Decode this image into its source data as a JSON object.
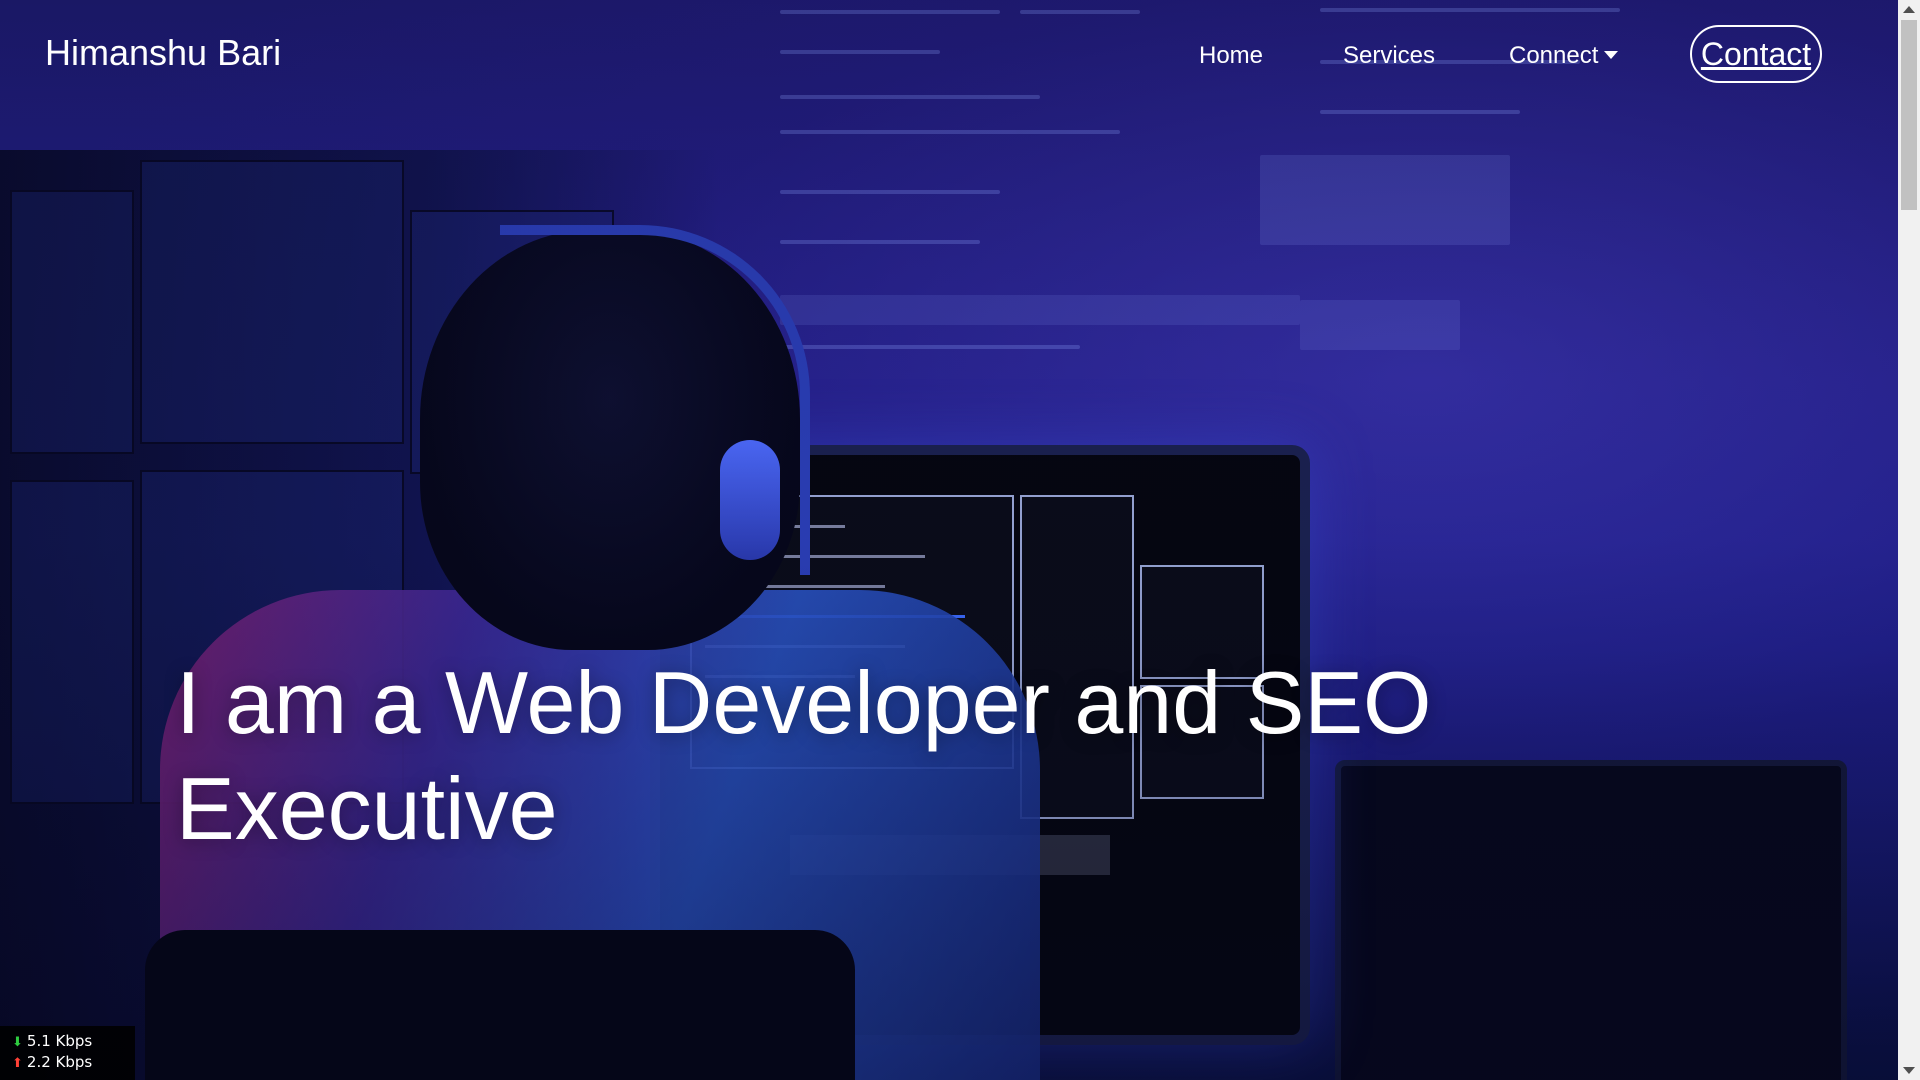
{
  "navbar": {
    "brand": "Himanshu Bari",
    "links": {
      "home": "Home",
      "services": "Services",
      "connect": "Connect"
    },
    "contact_button": "Contact"
  },
  "hero": {
    "title": "I am a Web Developer and SEO Executive"
  },
  "network_monitor": {
    "download": "5.1 Kbps",
    "upload": "2.2 Kbps"
  },
  "icons": {
    "dropdown": "chevron-down-icon",
    "download": "arrow-down-icon",
    "upload": "arrow-up-icon"
  },
  "colors": {
    "background_primary": "#1d1a6e",
    "background_accent": "#2a55c8",
    "text": "#ffffff"
  }
}
